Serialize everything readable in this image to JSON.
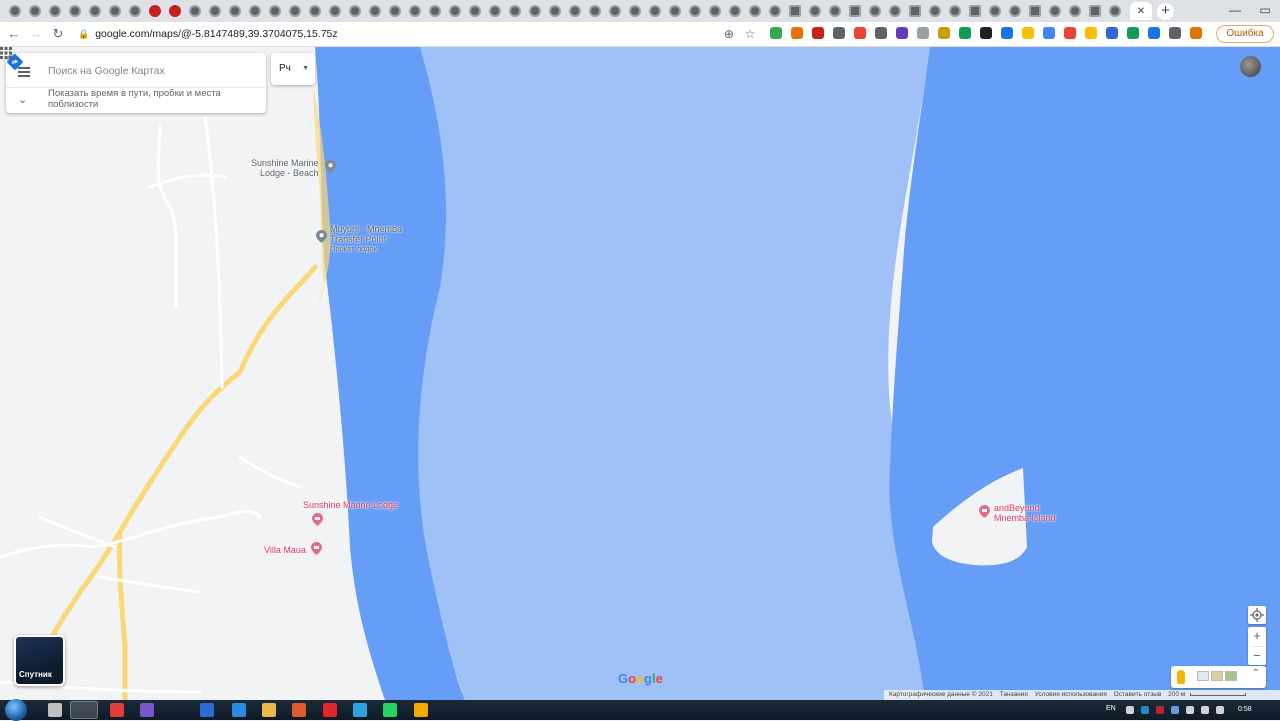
{
  "browser": {
    "url": "google.com/maps/@-5.8147489,39.3704075,15.75z",
    "error_button": "Ошибка",
    "new_tab": "+",
    "close_tab": "✕"
  },
  "search": {
    "placeholder": "Поиск на Google Картах",
    "traffic_prompt": "Показать время в пути, пробки и места поблизости",
    "category_label": "Рч"
  },
  "places": [
    {
      "name": "Sunshine Marine Lodge - Beach",
      "line1": "Sunshine Marine",
      "line2": "Lodge - Beach",
      "style": "gray"
    },
    {
      "name": "Muyuni - Mnemba Transfer Point",
      "line1": "Muyuni - Mnemba",
      "line2": "Transfer Point",
      "line3": "Прокат лодок",
      "style": "gray"
    },
    {
      "name": "Sunshine Marine Lodge",
      "line1": "Sunshine Marine Lodge",
      "style": "pink"
    },
    {
      "name": "Villa Maua",
      "line1": "Villa Maua",
      "style": "pink"
    },
    {
      "name": "andBeyond Mnemba Island",
      "line1": "andBeyond",
      "line2": "Mnemba Island",
      "style": "pink"
    }
  ],
  "map_controls": {
    "satellite_label": "Спутник",
    "logo": "Google",
    "zoom_in": "+",
    "zoom_out": "−"
  },
  "footer": {
    "map_data": "Картографические данные © 2021",
    "country": "Танзания",
    "terms": "Условия использования",
    "feedback": "Оставить отзыв",
    "scale": "200 м"
  },
  "taskbar": {
    "language": "EN",
    "time": "0:58"
  },
  "colors": {
    "water_deep": "#669df6",
    "water_shallow": "#a0c1f8",
    "land": "#f1f3f4",
    "road": "#fbd877",
    "poi_pink": "#d93a5d"
  }
}
